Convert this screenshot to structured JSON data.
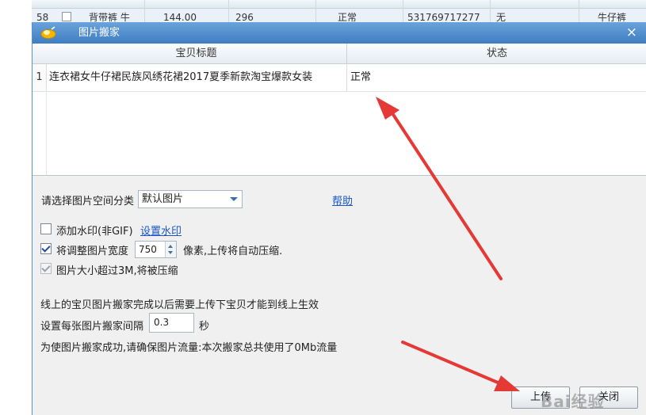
{
  "background_table": {
    "row_number": "58",
    "cells": [
      "背带裤 牛",
      "144.00",
      "296",
      "正常",
      "531769717277",
      "无",
      "牛仔裤"
    ]
  },
  "dialog": {
    "title": "图片搬家",
    "close_label": "×",
    "grid": {
      "columns": [
        "宝贝标题",
        "状态"
      ],
      "rows": [
        {
          "num": "1",
          "title": "连衣裙女牛仔裙民族风绣花裙2017夏季新款淘宝爆款女装",
          "status": "正常"
        }
      ]
    },
    "category": {
      "label": "请选择图片空间分类",
      "selected": "默认图片"
    },
    "help_link": "帮助",
    "watermark_option": {
      "checked": false,
      "label": "添加水印(非GIF)",
      "link": "设置水印"
    },
    "resize_option": {
      "checked": true,
      "label": "将调整图片宽度",
      "width_value": "750",
      "suffix": "像素,上传将自动压缩."
    },
    "size_option": {
      "checked": true,
      "disabled": true,
      "label": "图片大小超过3M,将被压缩"
    },
    "notice": "线上的宝贝图片搬家完成以后需要上传下宝贝才能到线上生效",
    "interval": {
      "label": "设置每张图片搬家间隔",
      "value": "0.3",
      "unit": "秒"
    },
    "traffic_note": "为使图片搬家成功,请确保图片流量:本次搬家总共使用了0Mb流量",
    "buttons": {
      "upload": "上传",
      "close": "关闭"
    }
  },
  "colors": {
    "titlebar": "#4a88cb",
    "link": "#1a55c9",
    "arrow": "#e53935"
  },
  "watermark_text": "Bai经验"
}
